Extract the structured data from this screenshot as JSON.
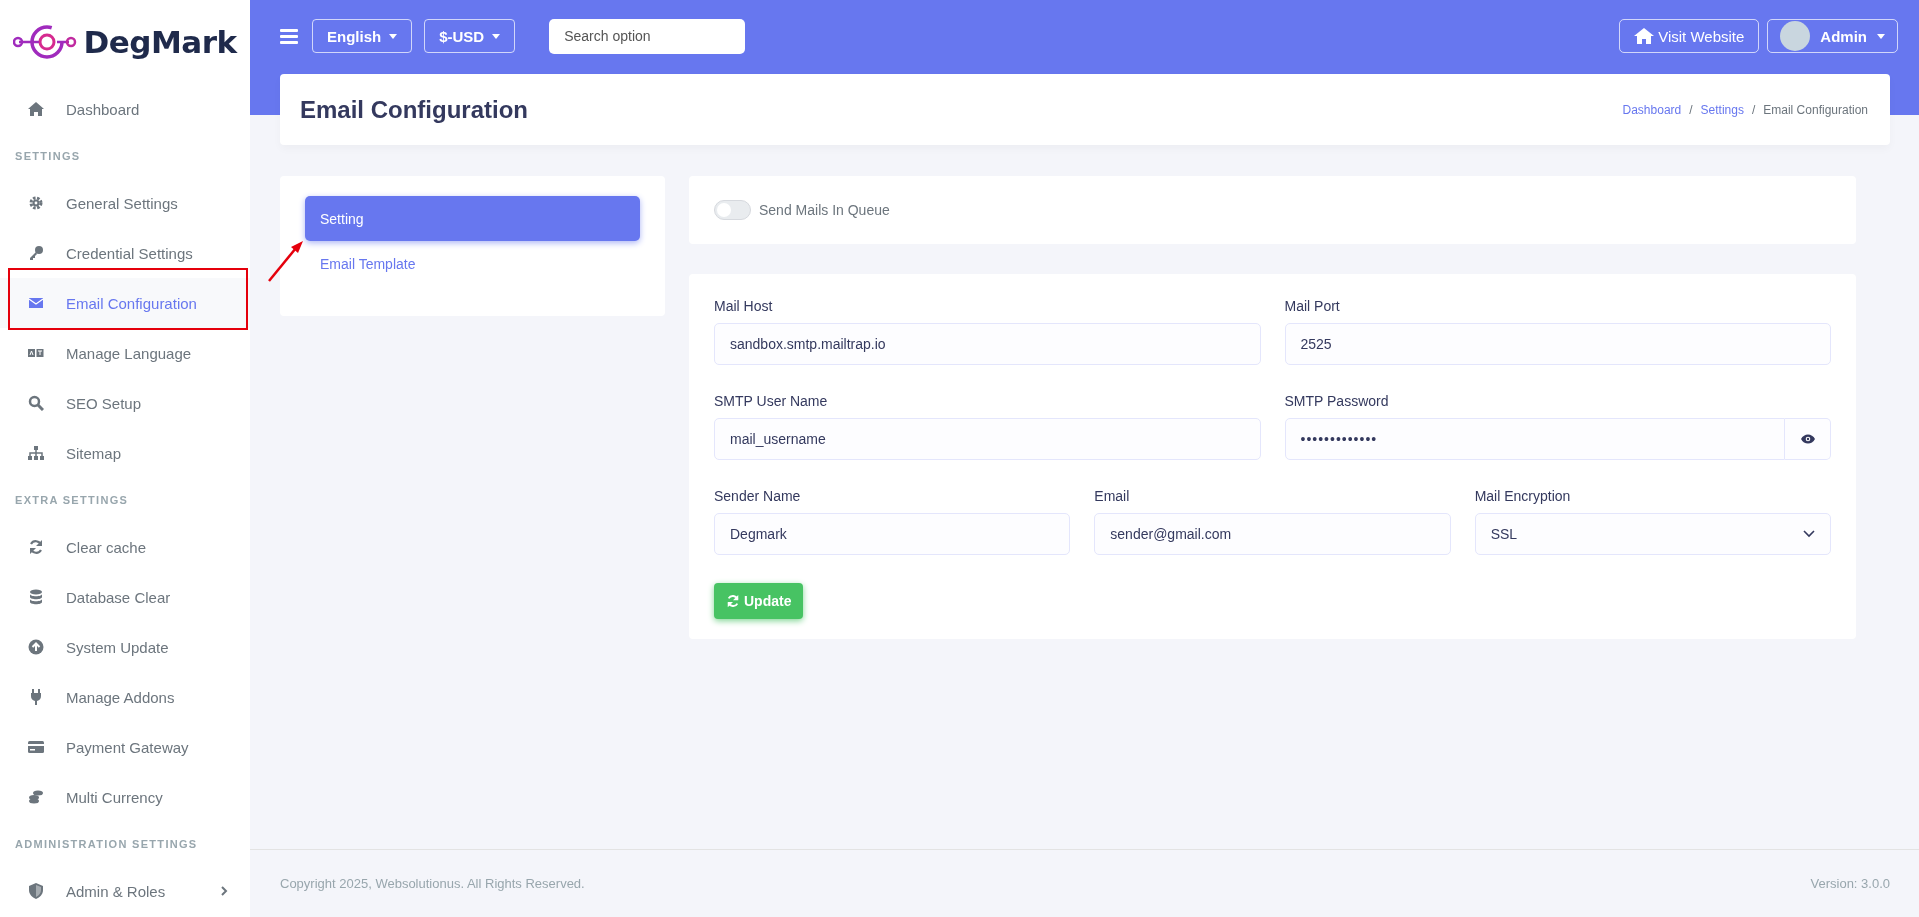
{
  "sidebar": {
    "logo": "DegMark",
    "items": [
      {
        "kind": "link",
        "label": "Dashboard",
        "selected": false
      },
      {
        "kind": "section",
        "label": "SETTINGS"
      },
      {
        "kind": "link",
        "label": "General Settings",
        "selected": false
      },
      {
        "kind": "link",
        "label": "Credential Settings",
        "selected": false
      },
      {
        "kind": "link",
        "label": "Email Configuration",
        "selected": true
      },
      {
        "kind": "link",
        "label": "Manage Language",
        "selected": false
      },
      {
        "kind": "link",
        "label": "SEO Setup",
        "selected": false
      },
      {
        "kind": "link",
        "label": "Sitemap",
        "selected": false
      },
      {
        "kind": "section",
        "label": "EXTRA SETTINGS"
      },
      {
        "kind": "link",
        "label": "Clear cache",
        "selected": false
      },
      {
        "kind": "link",
        "label": "Database Clear",
        "selected": false
      },
      {
        "kind": "link",
        "label": "System Update",
        "selected": false
      },
      {
        "kind": "link",
        "label": "Manage Addons",
        "selected": false
      },
      {
        "kind": "link",
        "label": "Payment Gateway",
        "selected": false
      },
      {
        "kind": "link",
        "label": "Multi Currency",
        "selected": false
      },
      {
        "kind": "section",
        "label": "ADMINISTRATION SETTINGS"
      },
      {
        "kind": "link",
        "label": "Admin & Roles",
        "selected": false,
        "expanded": false
      }
    ]
  },
  "topbar": {
    "language": "English",
    "currency": "$-USD",
    "search": {
      "placeholder": "Search option"
    },
    "visit_website": "Visit Website",
    "user": "Admin"
  },
  "page_title": "Email Configuration",
  "breadcrumb": {
    "separator": [
      "/",
      "/"
    ],
    "items": [
      {
        "label": "Dashboard",
        "link": true
      },
      {
        "label": "Settings",
        "link": true
      },
      {
        "label": "Email Configuration",
        "link": false
      }
    ]
  },
  "tabs": [
    {
      "label": "Setting",
      "selected": true
    },
    {
      "label": "Email Template",
      "selected": false
    }
  ],
  "queue_toggle": {
    "label": "Send Mails In Queue",
    "on": false
  },
  "form": {
    "rows": [
      [
        {
          "kind": "text",
          "label": "Mail Host",
          "value": "sandbox.smtp.mailtrap.io"
        },
        {
          "kind": "text",
          "label": "Mail Port",
          "value": "2525"
        }
      ],
      [
        {
          "kind": "text",
          "label": "SMTP User Name",
          "value": "mail_username"
        },
        {
          "kind": "password",
          "label": "SMTP Password",
          "value": "•••••••••••••"
        }
      ],
      [
        {
          "kind": "text",
          "label": "Sender Name",
          "value": "Degmark"
        },
        {
          "kind": "text",
          "label": "Email",
          "value": "sender@gmail.com"
        },
        {
          "kind": "select",
          "label": "Mail Encryption",
          "value": "SSL"
        }
      ]
    ],
    "submit": "Update"
  },
  "footer": {
    "copyright": "Copyright 2025, Websolutionus. All Rights Reserved.",
    "version": "Version: 3.0.0"
  }
}
